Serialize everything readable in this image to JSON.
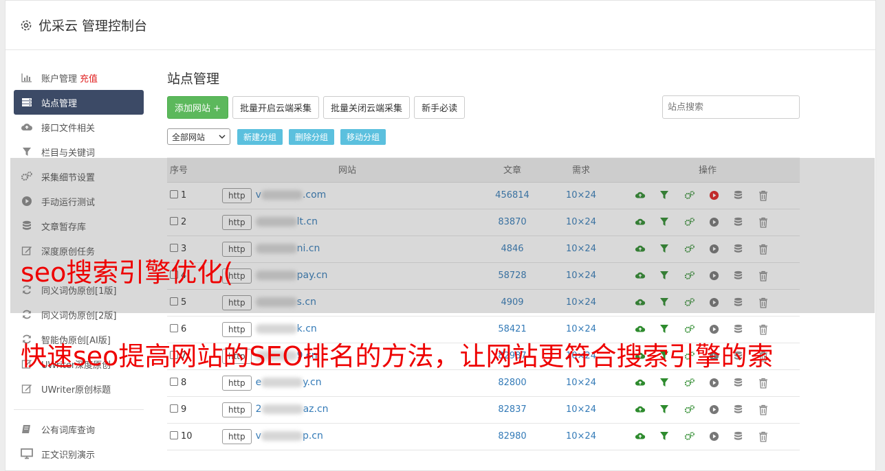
{
  "header": {
    "title": "优采云 管理控制台",
    "icon": "gear-icon"
  },
  "sidebar": {
    "items": [
      {
        "label": "账户管理",
        "extra": "充值",
        "icon": "bar-chart-icon",
        "active": false
      },
      {
        "label": "站点管理",
        "icon": "server-icon",
        "active": true
      },
      {
        "label": "接口文件相关",
        "icon": "cloud-upload-icon",
        "active": false
      },
      {
        "label": "栏目与关键词",
        "icon": "filter-icon",
        "active": false
      },
      {
        "label": "采集细节设置",
        "icon": "cogs-icon",
        "active": false
      },
      {
        "label": "手动运行测试",
        "icon": "play-circle-icon",
        "active": false
      },
      {
        "label": "文章暂存库",
        "icon": "database-icon",
        "active": false
      },
      {
        "label": "深度原创任务",
        "icon": "edit-icon",
        "active": false
      },
      {
        "label": "",
        "icon": "",
        "active": false
      },
      {
        "label": "同义词伪原创[1版]",
        "icon": "refresh-icon",
        "active": false
      },
      {
        "label": "同义词伪原创[2版]",
        "icon": "refresh-icon",
        "active": false
      },
      {
        "label": "智能伪原创[AI版]",
        "icon": "refresh-icon",
        "active": false
      },
      {
        "label": "UWriter深度原创",
        "icon": "edit-icon",
        "active": false
      },
      {
        "label": "UWriter原创标题",
        "icon": "edit-icon",
        "active": false
      }
    ],
    "bottom_items": [
      {
        "label": "公有词库查询",
        "icon": "book-icon"
      },
      {
        "label": "正文识别演示",
        "icon": "monitor-icon"
      }
    ]
  },
  "main": {
    "title": "站点管理",
    "buttons": {
      "add_site": "添加网站 +",
      "batch_enable": "批量开启云端采集",
      "batch_disable": "批量关闭云端采集",
      "newbie": "新手必读"
    },
    "search": {
      "placeholder": "站点搜索"
    },
    "group_select": "全部网站",
    "group_buttons": {
      "new": "新建分组",
      "delete": "删除分组",
      "move": "移动分组"
    },
    "table": {
      "headers": {
        "idx": "序号",
        "site": "网站",
        "articles": "文章",
        "demand": "需求",
        "ops": "操作"
      },
      "rows": [
        {
          "idx": "1",
          "proto": "http",
          "pre": "v",
          "site": ".com",
          "articles": "456814",
          "demand": "10×24",
          "active": true
        },
        {
          "idx": "2",
          "proto": "http",
          "pre": "",
          "site": "lt.cn",
          "articles": "83870",
          "demand": "10×24",
          "active": false
        },
        {
          "idx": "3",
          "proto": "http",
          "pre": "",
          "site": "ni.cn",
          "articles": "4846",
          "demand": "10×24",
          "active": false
        },
        {
          "idx": "4",
          "proto": "http",
          "pre": "",
          "site": "pay.cn",
          "articles": "58728",
          "demand": "10×24",
          "active": false
        },
        {
          "idx": "5",
          "proto": "http",
          "pre": "",
          "site": "s.cn",
          "articles": "4909",
          "demand": "10×24",
          "active": false
        },
        {
          "idx": "6",
          "proto": "http",
          "pre": "",
          "site": "k.cn",
          "articles": "58421",
          "demand": "10×24",
          "active": false
        },
        {
          "idx": "7",
          "proto": "http",
          "pre": "",
          "site": "9.cn",
          "articles": "82987",
          "demand": "10×24",
          "active": false
        },
        {
          "idx": "8",
          "proto": "http",
          "pre": "e",
          "site": "y.cn",
          "articles": "82800",
          "demand": "10×24",
          "active": false
        },
        {
          "idx": "9",
          "proto": "http",
          "pre": "2",
          "site": "az.cn",
          "articles": "82837",
          "demand": "10×24",
          "active": false
        },
        {
          "idx": "10",
          "proto": "http",
          "pre": "v",
          "site": "p.cn",
          "articles": "82980",
          "demand": "10×24",
          "active": false
        }
      ]
    }
  },
  "overlay": {
    "line1": "seo搜索引擎优化(",
    "line2": "快速seo提高网站的SEO排名的方法，让网站更符合搜索引擎的索"
  },
  "colors": {
    "sidebar_active": "#3c4a66",
    "accent_green": "#5cb85c",
    "accent_blue": "#5bc0de",
    "link": "#337ab7",
    "overlay_text": "#ee0000",
    "op_green": "#2e8b2e",
    "op_red": "#e02020"
  }
}
